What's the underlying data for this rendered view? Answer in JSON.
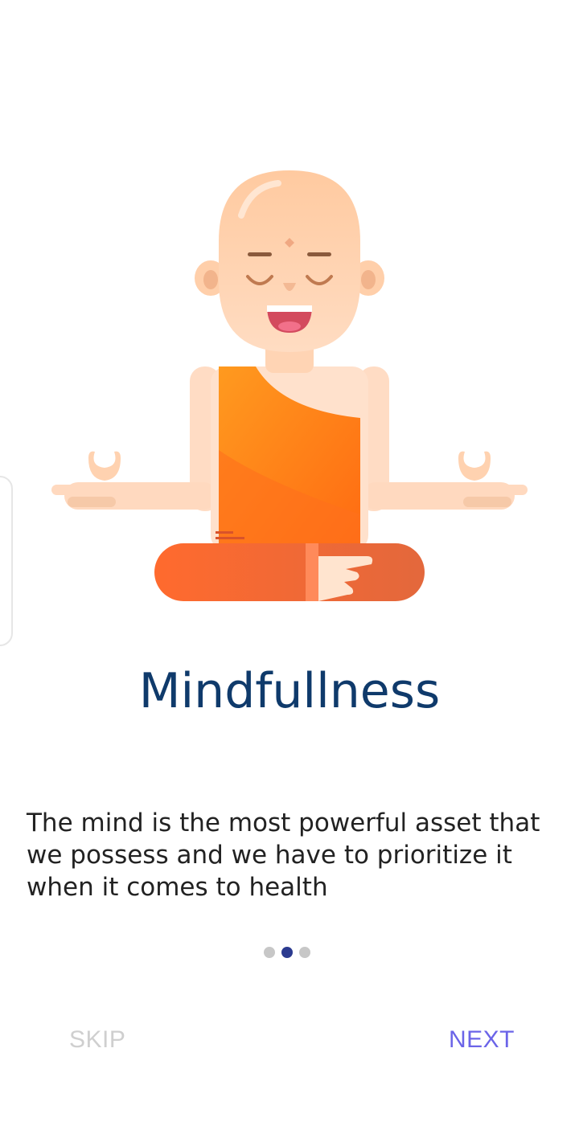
{
  "onboarding": {
    "title": "Mindfullness",
    "description": "The mind is the most powerful asset that we possess and we have to prioritize it when it comes to health",
    "page_indicator": {
      "total": 3,
      "current": 2
    },
    "illustration": "meditating-monk-illustration"
  },
  "actions": {
    "skip_label": "SKIP",
    "next_label": "NEXT"
  },
  "colors": {
    "title": "#0f3a6b",
    "next": "#6b64e8",
    "skip": "#cfcfcf",
    "dot_active": "#2b3a8f",
    "dot_inactive": "#c7c7c7",
    "robe": "#ff7a1c"
  }
}
